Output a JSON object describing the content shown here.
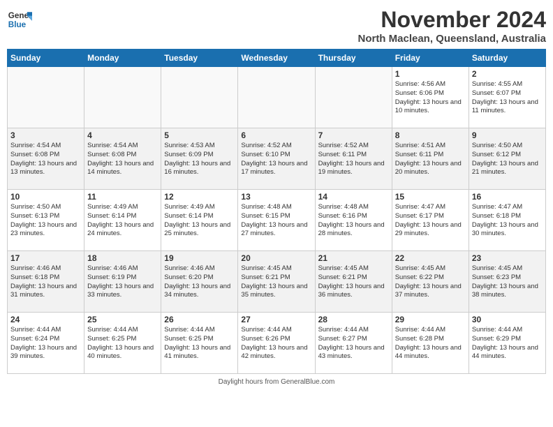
{
  "header": {
    "logo_line1": "General",
    "logo_line2": "Blue",
    "month": "November 2024",
    "location": "North Maclean, Queensland, Australia"
  },
  "weekdays": [
    "Sunday",
    "Monday",
    "Tuesday",
    "Wednesday",
    "Thursday",
    "Friday",
    "Saturday"
  ],
  "weeks": [
    [
      {
        "day": "",
        "info": ""
      },
      {
        "day": "",
        "info": ""
      },
      {
        "day": "",
        "info": ""
      },
      {
        "day": "",
        "info": ""
      },
      {
        "day": "",
        "info": ""
      },
      {
        "day": "1",
        "info": "Sunrise: 4:56 AM\nSunset: 6:06 PM\nDaylight: 13 hours\nand 10 minutes."
      },
      {
        "day": "2",
        "info": "Sunrise: 4:55 AM\nSunset: 6:07 PM\nDaylight: 13 hours\nand 11 minutes."
      }
    ],
    [
      {
        "day": "3",
        "info": "Sunrise: 4:54 AM\nSunset: 6:08 PM\nDaylight: 13 hours\nand 13 minutes."
      },
      {
        "day": "4",
        "info": "Sunrise: 4:54 AM\nSunset: 6:08 PM\nDaylight: 13 hours\nand 14 minutes."
      },
      {
        "day": "5",
        "info": "Sunrise: 4:53 AM\nSunset: 6:09 PM\nDaylight: 13 hours\nand 16 minutes."
      },
      {
        "day": "6",
        "info": "Sunrise: 4:52 AM\nSunset: 6:10 PM\nDaylight: 13 hours\nand 17 minutes."
      },
      {
        "day": "7",
        "info": "Sunrise: 4:52 AM\nSunset: 6:11 PM\nDaylight: 13 hours\nand 19 minutes."
      },
      {
        "day": "8",
        "info": "Sunrise: 4:51 AM\nSunset: 6:11 PM\nDaylight: 13 hours\nand 20 minutes."
      },
      {
        "day": "9",
        "info": "Sunrise: 4:50 AM\nSunset: 6:12 PM\nDaylight: 13 hours\nand 21 minutes."
      }
    ],
    [
      {
        "day": "10",
        "info": "Sunrise: 4:50 AM\nSunset: 6:13 PM\nDaylight: 13 hours\nand 23 minutes."
      },
      {
        "day": "11",
        "info": "Sunrise: 4:49 AM\nSunset: 6:14 PM\nDaylight: 13 hours\nand 24 minutes."
      },
      {
        "day": "12",
        "info": "Sunrise: 4:49 AM\nSunset: 6:14 PM\nDaylight: 13 hours\nand 25 minutes."
      },
      {
        "day": "13",
        "info": "Sunrise: 4:48 AM\nSunset: 6:15 PM\nDaylight: 13 hours\nand 27 minutes."
      },
      {
        "day": "14",
        "info": "Sunrise: 4:48 AM\nSunset: 6:16 PM\nDaylight: 13 hours\nand 28 minutes."
      },
      {
        "day": "15",
        "info": "Sunrise: 4:47 AM\nSunset: 6:17 PM\nDaylight: 13 hours\nand 29 minutes."
      },
      {
        "day": "16",
        "info": "Sunrise: 4:47 AM\nSunset: 6:18 PM\nDaylight: 13 hours\nand 30 minutes."
      }
    ],
    [
      {
        "day": "17",
        "info": "Sunrise: 4:46 AM\nSunset: 6:18 PM\nDaylight: 13 hours\nand 31 minutes."
      },
      {
        "day": "18",
        "info": "Sunrise: 4:46 AM\nSunset: 6:19 PM\nDaylight: 13 hours\nand 33 minutes."
      },
      {
        "day": "19",
        "info": "Sunrise: 4:46 AM\nSunset: 6:20 PM\nDaylight: 13 hours\nand 34 minutes."
      },
      {
        "day": "20",
        "info": "Sunrise: 4:45 AM\nSunset: 6:21 PM\nDaylight: 13 hours\nand 35 minutes."
      },
      {
        "day": "21",
        "info": "Sunrise: 4:45 AM\nSunset: 6:21 PM\nDaylight: 13 hours\nand 36 minutes."
      },
      {
        "day": "22",
        "info": "Sunrise: 4:45 AM\nSunset: 6:22 PM\nDaylight: 13 hours\nand 37 minutes."
      },
      {
        "day": "23",
        "info": "Sunrise: 4:45 AM\nSunset: 6:23 PM\nDaylight: 13 hours\nand 38 minutes."
      }
    ],
    [
      {
        "day": "24",
        "info": "Sunrise: 4:44 AM\nSunset: 6:24 PM\nDaylight: 13 hours\nand 39 minutes."
      },
      {
        "day": "25",
        "info": "Sunrise: 4:44 AM\nSunset: 6:25 PM\nDaylight: 13 hours\nand 40 minutes."
      },
      {
        "day": "26",
        "info": "Sunrise: 4:44 AM\nSunset: 6:25 PM\nDaylight: 13 hours\nand 41 minutes."
      },
      {
        "day": "27",
        "info": "Sunrise: 4:44 AM\nSunset: 6:26 PM\nDaylight: 13 hours\nand 42 minutes."
      },
      {
        "day": "28",
        "info": "Sunrise: 4:44 AM\nSunset: 6:27 PM\nDaylight: 13 hours\nand 43 minutes."
      },
      {
        "day": "29",
        "info": "Sunrise: 4:44 AM\nSunset: 6:28 PM\nDaylight: 13 hours\nand 44 minutes."
      },
      {
        "day": "30",
        "info": "Sunrise: 4:44 AM\nSunset: 6:29 PM\nDaylight: 13 hours\nand 44 minutes."
      }
    ]
  ],
  "footer": {
    "source_label": "Daylight hours",
    "source_url": "GeneralBlue.com"
  }
}
